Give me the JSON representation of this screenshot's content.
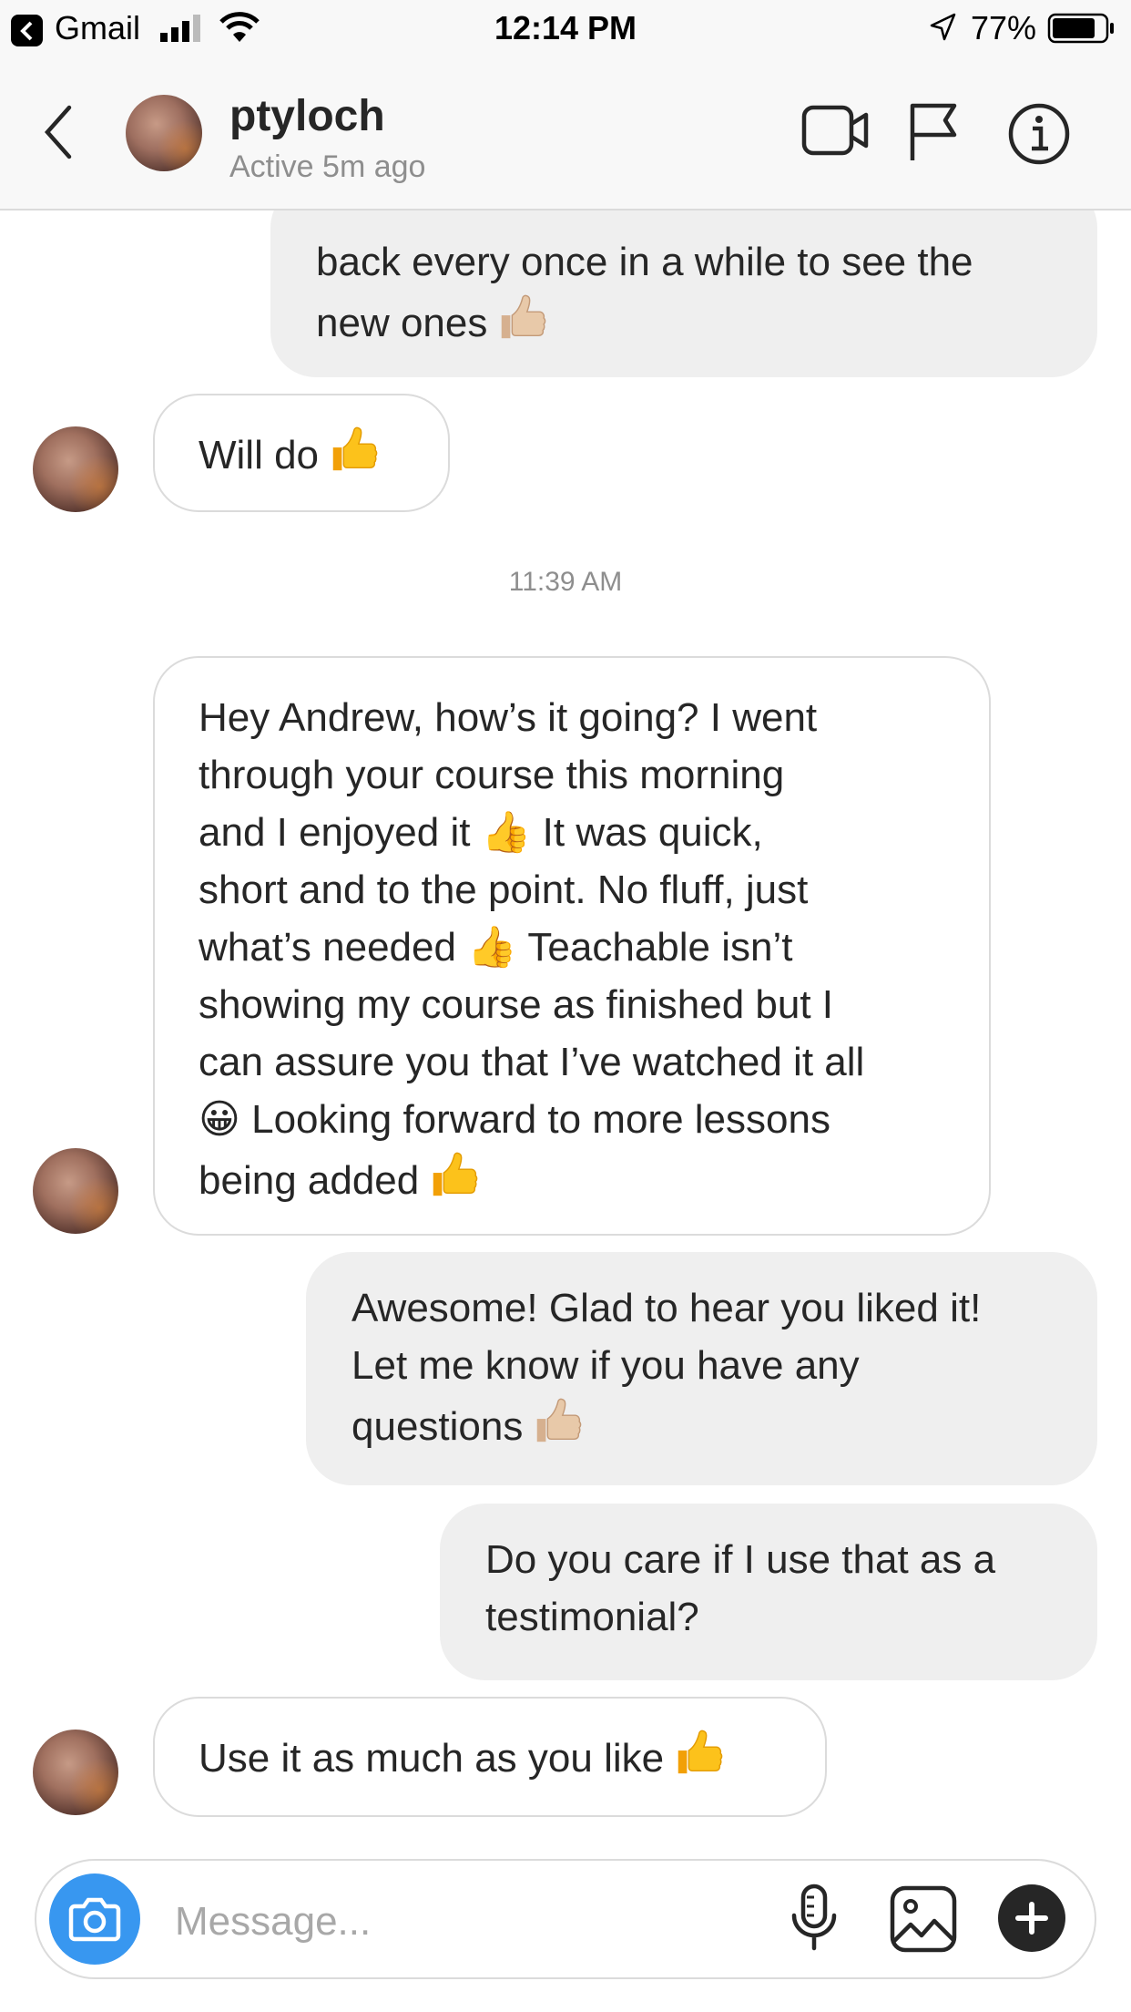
{
  "status_bar": {
    "back_app": "Gmail",
    "time": "12:14 PM",
    "battery": "77%",
    "icons": [
      "back-chevron-icon",
      "signal-icon",
      "wifi-icon",
      "location-arrow-icon",
      "battery-icon"
    ]
  },
  "header": {
    "username": "ptyloch",
    "active_status": "Active 5m ago",
    "icons": [
      "back-chevron-icon",
      "video-camera-icon",
      "flag-icon",
      "info-icon"
    ]
  },
  "messages": [
    {
      "direction": "outgoing",
      "text": "back every once in a while to see the\nnew ones",
      "emoji": "thumbs-up-light"
    },
    {
      "direction": "incoming",
      "text": "Will do",
      "emoji": "thumbs-up"
    },
    {
      "direction": "timestamp",
      "text": "11:39 AM"
    },
    {
      "direction": "incoming",
      "text": "Hey Andrew, how’s it going? I went\nthrough your course this morning\nand I enjoyed it 👍 It was quick,\nshort and to the point. No fluff, just\nwhat’s needed 👍 Teachable isn’t\nshowing my course as finished but I\ncan assure you that I’ve watched it all\n😀 Looking forward to more lessons\nbeing added",
      "emoji": "thumbs-up"
    },
    {
      "direction": "outgoing",
      "text": "Awesome! Glad to hear you liked it!\nLet me know if you have any\nquestions",
      "emoji": "thumbs-up-light"
    },
    {
      "direction": "outgoing",
      "text": "Do you care if I use that as a\ntestimonial?"
    },
    {
      "direction": "incoming",
      "text": "Use it as much as you like",
      "emoji": "thumbs-up"
    }
  ],
  "composer": {
    "placeholder": "Message...",
    "icons": [
      "camera-icon",
      "microphone-icon",
      "gallery-icon",
      "plus-icon"
    ]
  },
  "colors": {
    "accent": "#3897f0",
    "outgoing_bubble": "#efefef",
    "incoming_border": "#dbdbdb",
    "text": "#262626",
    "secondary_text": "#8e8e8e",
    "thumbs_up": "#fcc21b",
    "thumbs_up_light": "#e3c1a1"
  }
}
